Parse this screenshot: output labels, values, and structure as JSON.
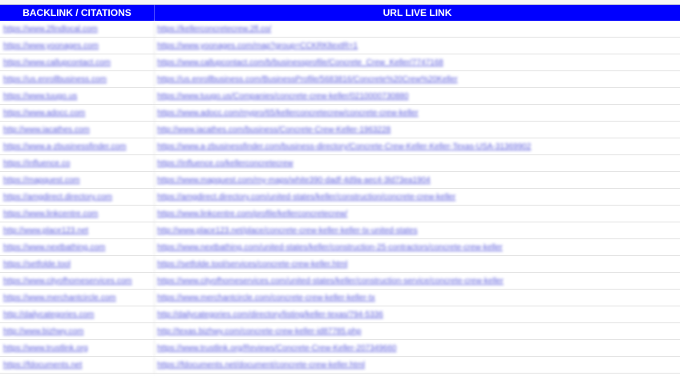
{
  "table": {
    "headers": {
      "col1": "BACKLINK / CITATIONS",
      "col2": "URL LIVE LINK"
    },
    "rows": [
      {
        "site": "https://www.2findlocal.com",
        "url": "https://kellerconcretecrew.2fl.co/"
      },
      {
        "site": "https://www.yoonages.com",
        "url": "https://www.yoonages.com/map?group=CCKRKltextR=1"
      },
      {
        "site": "https://www.callupcontact.com",
        "url": "https://www.callupcontact.com/b/businessprofile/Concrete_Crew_Keller/7747168"
      },
      {
        "site": "https://us.enrollbusiness.com",
        "url": "https://us.enrollbusiness.com/BusinessProfile/5683816/Concrete%20Crew%20Keller"
      },
      {
        "site": "https://www.tuugo.us",
        "url": "https://www.tuugo.us/Companies/concrete-crew-keller/0210000730880"
      },
      {
        "site": "https://www.adocc.com",
        "url": "https://www.adocc.com/mypro/65/kellerconcretecrew/concrete-crew-keller"
      },
      {
        "site": "http://www.iacathes.com",
        "url": "http://www.iacathes.com/business/Concrete-Crew-Keller-1963228"
      },
      {
        "site": "https://www.a-zbusinessfinder.com",
        "url": "https://www.a-zbusinessfinder.com/business-directory/Concrete-Crew-Keller-Keller-Texas-USA-31369902"
      },
      {
        "site": "https://influence.co",
        "url": "https://influence.co/kellerconcretecrew"
      },
      {
        "site": "https://mapquest.com",
        "url": "https://www.mapquest.com/my-maps/white390-dadf-4d9a-aec4-3ld73ea1904"
      },
      {
        "site": "https://amgdirect.directory.com",
        "url": "https://amgdirect.directory.com/united-states/keller/construction/concrete-crew-keller"
      },
      {
        "site": "https://www.linkcentre.com",
        "url": "https://www.linkcentre.com/profile/kellerconcretecrew/"
      },
      {
        "site": "http://www.place123.net",
        "url": "http://www.place123.net/place/concrete-crew-keller-keller-tx-united-states"
      },
      {
        "site": "https://www.nextbathing.com",
        "url": "https://www.nextbathing.com/united-states/keller/construction-25-contractors/concrete-crew-keller"
      },
      {
        "site": "https://setfolde.tool",
        "url": "https://setfolde.tool/services/concrete-crew-keller.html"
      },
      {
        "site": "https://www.cityofhomeservices.com",
        "url": "https://www.cityofhomeservices.com/united-states/keller/construction-service/concrete-crew-keller"
      },
      {
        "site": "https://www.merchantcircle.com",
        "url": "https://www.merchantcircle.com/concrete-crew-keller-keller-tx"
      },
      {
        "site": "http://dailycategories.com",
        "url": "http://dailycategories.com/directory/listing/keller-texas/794-5336"
      },
      {
        "site": "http://www.bizhwy.com",
        "url": "http://texas.bizhwy.com/concrete-crew-keller-id87785.php"
      },
      {
        "site": "https://www.trustlink.org",
        "url": "https://www.trustlink.org/Reviews/Concrete-Crew-Keller-207349660"
      },
      {
        "site": "https://fdocuments.net",
        "url": "https://fdocuments.net/document/concrete-crew-keller.html"
      }
    ]
  }
}
